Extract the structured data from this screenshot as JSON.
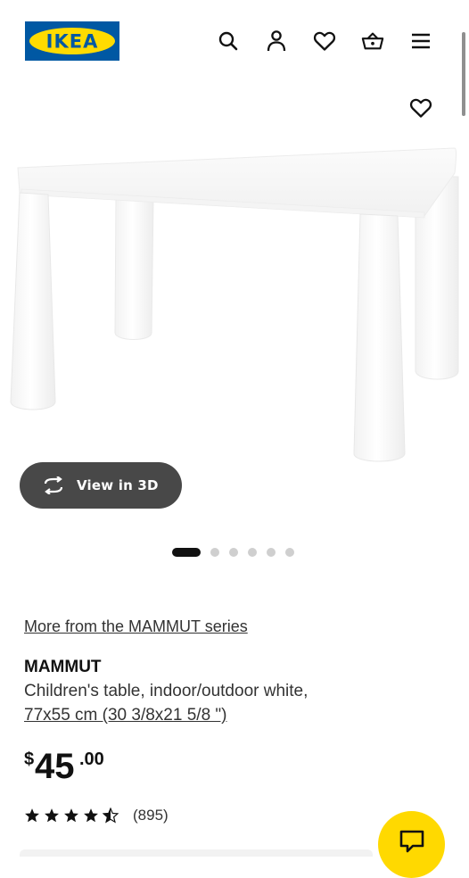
{
  "header": {
    "logo_text": "IKEA",
    "icons": [
      "search-icon",
      "profile-icon",
      "heart-icon",
      "shopping-bag-icon",
      "menu-icon"
    ]
  },
  "colors": {
    "brand_blue": "#0058a3",
    "brand_yellow": "#ffdb00",
    "view3d_bg": "#484848",
    "chat_bg": "#ffd900"
  },
  "product": {
    "favourite_icon": "heart-icon",
    "view3d_label": "View in 3D",
    "carousel": {
      "total": 6,
      "active": 1
    },
    "series_link": "More from the MAMMUT series",
    "name": "MAMMUT",
    "description": "Children's table, indoor/outdoor white,",
    "size": "77x55 cm (30 3/8x21 5/8 \")",
    "price": {
      "currency": "$",
      "integer": "45",
      "decimal": ".00"
    },
    "rating": {
      "stars": 4.5,
      "count": "(895)"
    }
  },
  "chat": {
    "icon": "chat-icon"
  }
}
